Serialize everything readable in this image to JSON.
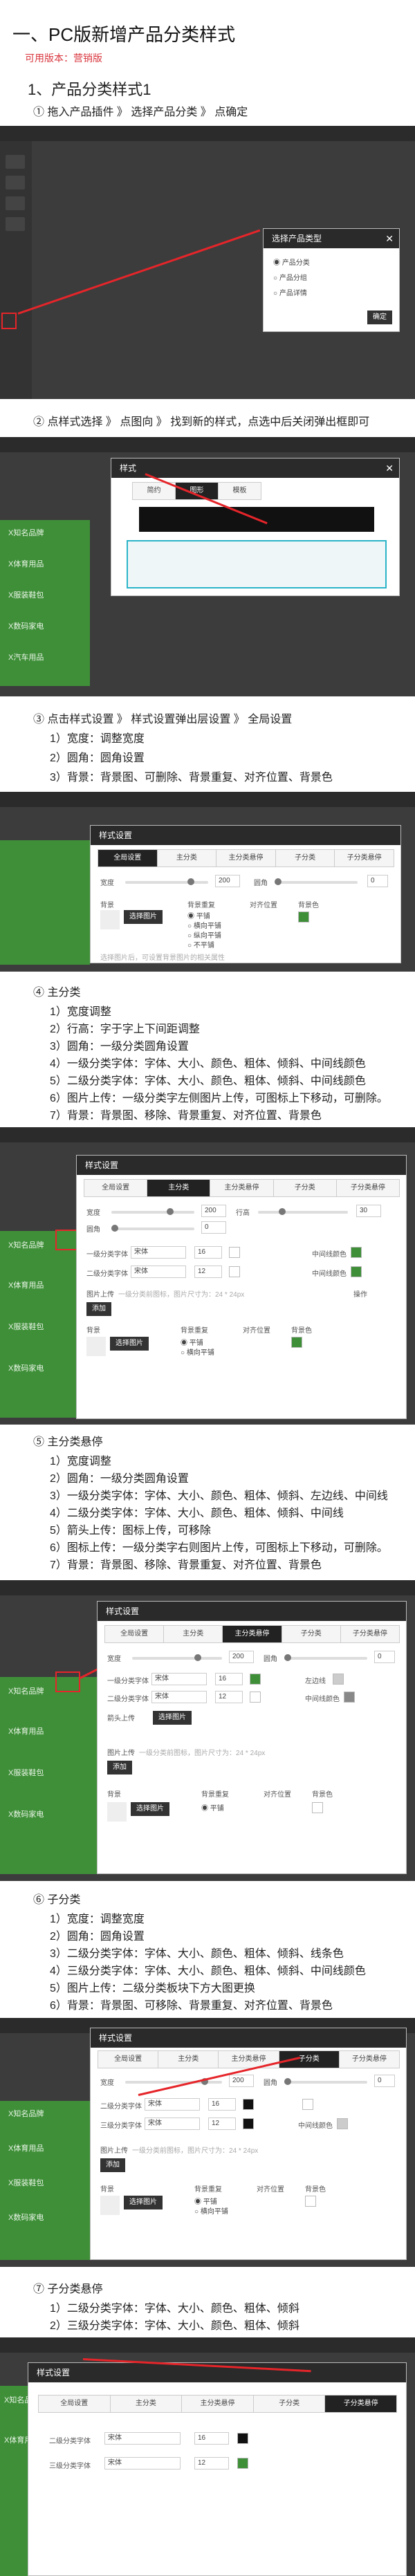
{
  "page": {
    "title": "一、PC版新增产品分类样式",
    "version": "可用版本：营销版",
    "section": "1、产品分类样式1",
    "step1": "① 拖入产品插件 》 选择产品分类 》 点确定",
    "step2": "② 点样式选择 》 点图向 》 找到新的样式，点选中后关闭弹出框即可",
    "step3": "③ 点击样式设置 》 样式设置弹出层设置 》 全局设置",
    "step3_items": [
      "1）宽度：调整宽度",
      "2）圆角：圆角设置",
      "3）背景：背景图、可删除、背景重复、对齐位置、背景色"
    ],
    "step4": "④ 主分类",
    "step4_items": [
      "1）宽度调整",
      "2）行高：字于字上下间距调整",
      "3）圆角：一级分类圆角设置",
      "4）一级分类字体：字体、大小、颜色、粗体、倾斜、中间线颜色",
      "5）二级分类字体：字体、大小、颜色、粗体、倾斜、中间线颜色",
      "6）图片上传：一级分类字左侧图片上传，可图标上下移动，可删除。",
      "7）背景：背景图、移除、背景重复、对齐位置、背景色"
    ],
    "step5": "⑤ 主分类悬停",
    "step5_items": [
      "1）宽度调整",
      "2）圆角：一级分类圆角设置",
      "3）一级分类字体：字体、大小、颜色、粗体、倾斜、左边线、中间线",
      "4）二级分类字体：字体、大小、颜色、粗体、倾斜、中间线",
      "5）箭头上传：图标上传，可移除",
      "6）图标上传：一级分类字右则图片上传，可图标上下移动，可删除。",
      "7）背景：背景图、移除、背景重复、对齐位置、背景色"
    ],
    "step6": "⑥ 子分类",
    "step6_items": [
      "1）宽度：调整宽度",
      "2）圆角：圆角设置",
      "3）二级分类字体：字体、大小、颜色、粗体、倾斜、线条色",
      "4）三级分类字体：字体、大小、颜色、粗体、倾斜、中间线颜色",
      "5）图片上传：二级分类板块下方大图更换",
      "6）背景：背景图、可移除、背景重复、对齐位置、背景色"
    ],
    "step7": "⑦ 子分类悬停",
    "step7_items": [
      "1）二级分类字体：字体、大小、颜色、粗体、倾斜",
      "2）三级分类字体：字体、大小、颜色、粗体、倾斜"
    ]
  },
  "ui": {
    "dlg_type_title": "选择产品类型",
    "dlg_type_options": [
      "产品分类",
      "产品分组",
      "产品详情"
    ],
    "dlg_type_ok": "确定",
    "dlg_style_title": "样式",
    "dlg_style_tabs": [
      "简约",
      "图形",
      "模板"
    ],
    "dlg_set_title": "样式设置",
    "dlg_set_tabs": [
      "全局设置",
      "主分类",
      "主分类悬停",
      "子分类",
      "子分类悬停"
    ],
    "lbl_width": "宽度",
    "lbl_radius": "圆角",
    "lbl_lineheight": "行高",
    "lbl_bgimg": "背景图片",
    "lbl_bgrepeat": "背景重复",
    "lbl_align": "对齐位置",
    "lbl_bgcolor": "背景色",
    "lbl_pick": "选择图片",
    "lbl_remove": "移除",
    "repeat_opts": [
      "平铺",
      "横向平铺",
      "纵向平铺",
      "不平铺"
    ],
    "lbl_font1": "一级分类字体",
    "lbl_font2": "二级分类字体",
    "lbl_font3": "三级分类字体",
    "font_name": "宋体",
    "font_size": "16",
    "font_size2": "12",
    "lbl_midline": "中间线颜色",
    "lbl_leftline": "左边线",
    "lbl_upload": "图片上传",
    "lbl_upload_hint": "一级分类前图标，图片尺寸为：24 * 24px",
    "lbl_arrow": "箭头上传",
    "lbl_add": "添加",
    "lbl_op": "操作",
    "bg_hint": "选择图片后，可设置背景图片的相关属性",
    "val_width": "200",
    "val_radius": "0",
    "val_lh": "30",
    "bg_label": "背景",
    "menu_items": [
      "X知名品牌",
      "X体育用品",
      "X服装鞋包",
      "X数码家电",
      "X汽车用品"
    ],
    "colors": {
      "green": "#3f8f39",
      "dark": "#2a2a2a",
      "accent": "#e5252a"
    }
  }
}
